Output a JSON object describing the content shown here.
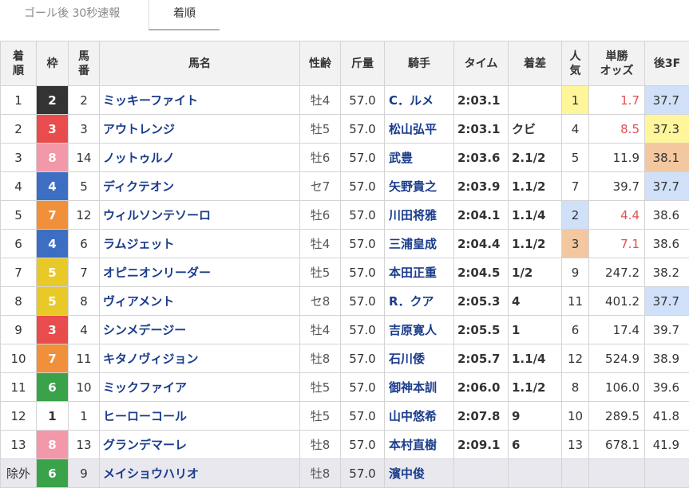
{
  "tabs": [
    "ゴール後 30秒速報",
    "着順"
  ],
  "headers": {
    "rank": [
      "着",
      "順"
    ],
    "frame": "枠",
    "num": [
      "馬",
      "番"
    ],
    "name": "馬名",
    "sexage": "性齢",
    "weight": "斤量",
    "jockey": "騎手",
    "time": "タイム",
    "margin": "着差",
    "pop": [
      "人",
      "気"
    ],
    "odds": [
      "単勝",
      "オッズ"
    ],
    "last3f": "後3F"
  },
  "frame_colors": {
    "1": {
      "bg": "#ffffff",
      "fg": "#333333"
    },
    "2": {
      "bg": "#333333",
      "fg": "#ffffff"
    },
    "3": {
      "bg": "#e94c4c",
      "fg": "#ffffff"
    },
    "4": {
      "bg": "#3c6fc4",
      "fg": "#ffffff"
    },
    "5": {
      "bg": "#e9c928",
      "fg": "#ffffff"
    },
    "6": {
      "bg": "#3aa34a",
      "fg": "#ffffff"
    },
    "7": {
      "bg": "#f0903a",
      "fg": "#ffffff"
    },
    "8": {
      "bg": "#f298a8",
      "fg": "#ffffff"
    }
  },
  "highlight_colors": {
    "gold": "#fff59a",
    "silver": "#cfe0f8",
    "bronze": "#f3c7a0"
  },
  "rows": [
    {
      "rank": "1",
      "frame": "2",
      "num": "2",
      "name": "ミッキーファイト",
      "sexage": "牡4",
      "weight": "57.0",
      "jockey": "C．ルメ",
      "time": "2:03.1",
      "margin": "",
      "pop": "1",
      "odds": "1.7",
      "last3f": "37.7",
      "pop_hl": "gold",
      "last3f_hl": "silver"
    },
    {
      "rank": "2",
      "frame": "3",
      "num": "3",
      "name": "アウトレンジ",
      "sexage": "牡5",
      "weight": "57.0",
      "jockey": "松山弘平",
      "time": "2:03.1",
      "margin": "クビ",
      "pop": "4",
      "odds": "8.5",
      "last3f": "37.3",
      "pop_hl": "",
      "last3f_hl": "gold"
    },
    {
      "rank": "3",
      "frame": "8",
      "num": "14",
      "name": "ノットゥルノ",
      "sexage": "牡6",
      "weight": "57.0",
      "jockey": "武豊",
      "time": "2:03.6",
      "margin": "2.1/2",
      "pop": "5",
      "odds": "11.9",
      "last3f": "38.1",
      "pop_hl": "",
      "last3f_hl": "bronze"
    },
    {
      "rank": "4",
      "frame": "4",
      "num": "5",
      "name": "ディクテオン",
      "sexage": "セ7",
      "weight": "57.0",
      "jockey": "矢野貴之",
      "time": "2:03.9",
      "margin": "1.1/2",
      "pop": "7",
      "odds": "39.7",
      "last3f": "37.7",
      "pop_hl": "",
      "last3f_hl": "silver"
    },
    {
      "rank": "5",
      "frame": "7",
      "num": "12",
      "name": "ウィルソンテソーロ",
      "sexage": "牡6",
      "weight": "57.0",
      "jockey": "川田将雅",
      "time": "2:04.1",
      "margin": "1.1/4",
      "pop": "2",
      "odds": "4.4",
      "last3f": "38.6",
      "pop_hl": "silver",
      "last3f_hl": ""
    },
    {
      "rank": "6",
      "frame": "4",
      "num": "6",
      "name": "ラムジェット",
      "sexage": "牡4",
      "weight": "57.0",
      "jockey": "三浦皇成",
      "time": "2:04.4",
      "margin": "1.1/2",
      "pop": "3",
      "odds": "7.1",
      "last3f": "38.6",
      "pop_hl": "bronze",
      "last3f_hl": ""
    },
    {
      "rank": "7",
      "frame": "5",
      "num": "7",
      "name": "オピニオンリーダー",
      "sexage": "牡5",
      "weight": "57.0",
      "jockey": "本田正重",
      "time": "2:04.5",
      "margin": "1/2",
      "pop": "9",
      "odds": "247.2",
      "last3f": "38.2",
      "pop_hl": "",
      "last3f_hl": ""
    },
    {
      "rank": "8",
      "frame": "5",
      "num": "8",
      "name": "ヴィアメント",
      "sexage": "セ8",
      "weight": "57.0",
      "jockey": "R．クア",
      "time": "2:05.3",
      "margin": "4",
      "pop": "11",
      "odds": "401.2",
      "last3f": "37.7",
      "pop_hl": "",
      "last3f_hl": "silver"
    },
    {
      "rank": "9",
      "frame": "3",
      "num": "4",
      "name": "シンメデージー",
      "sexage": "牡4",
      "weight": "57.0",
      "jockey": "吉原寛人",
      "time": "2:05.5",
      "margin": "1",
      "pop": "6",
      "odds": "17.4",
      "last3f": "39.7",
      "pop_hl": "",
      "last3f_hl": ""
    },
    {
      "rank": "10",
      "frame": "7",
      "num": "11",
      "name": "キタノヴィジョン",
      "sexage": "牡8",
      "weight": "57.0",
      "jockey": "石川倭",
      "time": "2:05.7",
      "margin": "1.1/4",
      "pop": "12",
      "odds": "524.9",
      "last3f": "38.9",
      "pop_hl": "",
      "last3f_hl": ""
    },
    {
      "rank": "11",
      "frame": "6",
      "num": "10",
      "name": "ミックファイア",
      "sexage": "牡5",
      "weight": "57.0",
      "jockey": "御神本訓",
      "time": "2:06.0",
      "margin": "1.1/2",
      "pop": "8",
      "odds": "106.0",
      "last3f": "39.6",
      "pop_hl": "",
      "last3f_hl": ""
    },
    {
      "rank": "12",
      "frame": "1",
      "num": "1",
      "name": "ヒーローコール",
      "sexage": "牡5",
      "weight": "57.0",
      "jockey": "山中悠希",
      "time": "2:07.8",
      "margin": "9",
      "pop": "10",
      "odds": "289.5",
      "last3f": "41.8",
      "pop_hl": "",
      "last3f_hl": ""
    },
    {
      "rank": "13",
      "frame": "8",
      "num": "13",
      "name": "グランデマーレ",
      "sexage": "牡8",
      "weight": "57.0",
      "jockey": "本村直樹",
      "time": "2:09.1",
      "margin": "6",
      "pop": "13",
      "odds": "678.1",
      "last3f": "41.9",
      "pop_hl": "",
      "last3f_hl": ""
    },
    {
      "rank": "除外",
      "frame": "6",
      "num": "9",
      "name": "メイショウハリオ",
      "sexage": "牡8",
      "weight": "57.0",
      "jockey": "濱中俊",
      "time": "",
      "margin": "",
      "pop": "",
      "odds": "",
      "last3f": "",
      "pop_hl": "",
      "last3f_hl": "",
      "excluded": true
    }
  ]
}
